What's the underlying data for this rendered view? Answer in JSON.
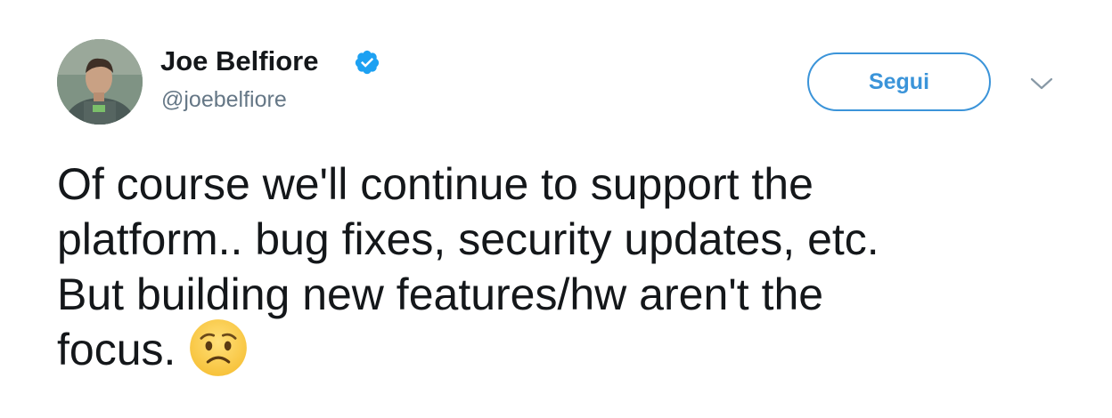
{
  "user": {
    "display_name": "Joe Belfiore",
    "screen_name": "@joebelfiore",
    "verified": true
  },
  "follow_button": {
    "label": "Segui"
  },
  "tweet": {
    "lines": [
      "Of course we'll continue to support the",
      "platform.. bug fixes, security updates, etc.",
      "But building new features/hw aren't the",
      "focus."
    ],
    "emoji": "worried-face"
  },
  "colors": {
    "accent": "#3b94d9",
    "verified_badge": "#1da1f2",
    "secondary_text": "#657786",
    "primary_text": "#14171a"
  },
  "icons": [
    "verified-badge-icon",
    "chevron-down-icon",
    "worried-face-emoji"
  ]
}
